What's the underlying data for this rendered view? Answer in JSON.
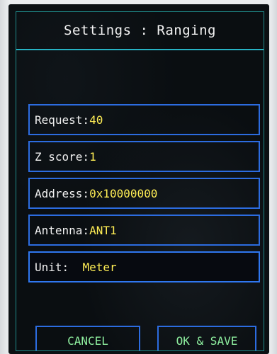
{
  "header": {
    "title": "Settings : Ranging"
  },
  "fields": [
    {
      "label": "Request:",
      "value": "40"
    },
    {
      "label": "Z score:",
      "value": "1"
    },
    {
      "label": "Address:",
      "value": "0x10000000"
    },
    {
      "label": "Antenna:",
      "value": "ANT1"
    },
    {
      "label": "Unit:  ",
      "value": "Meter"
    }
  ],
  "buttons": {
    "cancel_label": "CANCEL",
    "save_label": "OK & SAVE"
  },
  "colors": {
    "label": "#f0f0f0",
    "value": "#ffee55",
    "button_text": "#8ff0a0",
    "border_blue": "#2c6ce0",
    "title_underline": "#27b3c4"
  }
}
